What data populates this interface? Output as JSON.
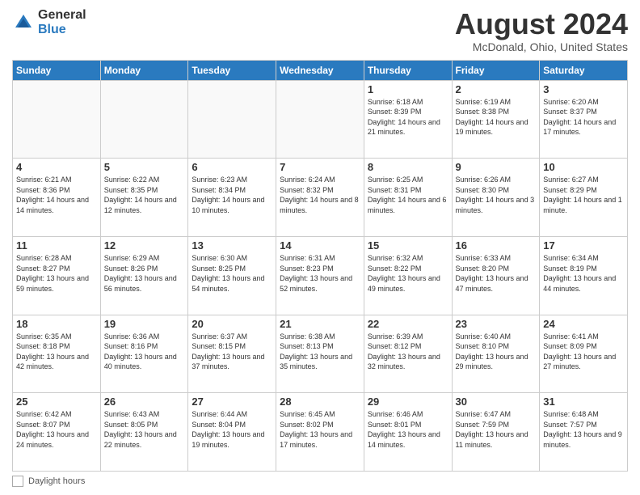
{
  "logo": {
    "general": "General",
    "blue": "Blue"
  },
  "title": "August 2024",
  "subtitle": "McDonald, Ohio, United States",
  "days_of_week": [
    "Sunday",
    "Monday",
    "Tuesday",
    "Wednesday",
    "Thursday",
    "Friday",
    "Saturday"
  ],
  "weeks": [
    [
      {
        "day": "",
        "info": ""
      },
      {
        "day": "",
        "info": ""
      },
      {
        "day": "",
        "info": ""
      },
      {
        "day": "",
        "info": ""
      },
      {
        "day": "1",
        "info": "Sunrise: 6:18 AM\nSunset: 8:39 PM\nDaylight: 14 hours and 21 minutes."
      },
      {
        "day": "2",
        "info": "Sunrise: 6:19 AM\nSunset: 8:38 PM\nDaylight: 14 hours and 19 minutes."
      },
      {
        "day": "3",
        "info": "Sunrise: 6:20 AM\nSunset: 8:37 PM\nDaylight: 14 hours and 17 minutes."
      }
    ],
    [
      {
        "day": "4",
        "info": "Sunrise: 6:21 AM\nSunset: 8:36 PM\nDaylight: 14 hours and 14 minutes."
      },
      {
        "day": "5",
        "info": "Sunrise: 6:22 AM\nSunset: 8:35 PM\nDaylight: 14 hours and 12 minutes."
      },
      {
        "day": "6",
        "info": "Sunrise: 6:23 AM\nSunset: 8:34 PM\nDaylight: 14 hours and 10 minutes."
      },
      {
        "day": "7",
        "info": "Sunrise: 6:24 AM\nSunset: 8:32 PM\nDaylight: 14 hours and 8 minutes."
      },
      {
        "day": "8",
        "info": "Sunrise: 6:25 AM\nSunset: 8:31 PM\nDaylight: 14 hours and 6 minutes."
      },
      {
        "day": "9",
        "info": "Sunrise: 6:26 AM\nSunset: 8:30 PM\nDaylight: 14 hours and 3 minutes."
      },
      {
        "day": "10",
        "info": "Sunrise: 6:27 AM\nSunset: 8:29 PM\nDaylight: 14 hours and 1 minute."
      }
    ],
    [
      {
        "day": "11",
        "info": "Sunrise: 6:28 AM\nSunset: 8:27 PM\nDaylight: 13 hours and 59 minutes."
      },
      {
        "day": "12",
        "info": "Sunrise: 6:29 AM\nSunset: 8:26 PM\nDaylight: 13 hours and 56 minutes."
      },
      {
        "day": "13",
        "info": "Sunrise: 6:30 AM\nSunset: 8:25 PM\nDaylight: 13 hours and 54 minutes."
      },
      {
        "day": "14",
        "info": "Sunrise: 6:31 AM\nSunset: 8:23 PM\nDaylight: 13 hours and 52 minutes."
      },
      {
        "day": "15",
        "info": "Sunrise: 6:32 AM\nSunset: 8:22 PM\nDaylight: 13 hours and 49 minutes."
      },
      {
        "day": "16",
        "info": "Sunrise: 6:33 AM\nSunset: 8:20 PM\nDaylight: 13 hours and 47 minutes."
      },
      {
        "day": "17",
        "info": "Sunrise: 6:34 AM\nSunset: 8:19 PM\nDaylight: 13 hours and 44 minutes."
      }
    ],
    [
      {
        "day": "18",
        "info": "Sunrise: 6:35 AM\nSunset: 8:18 PM\nDaylight: 13 hours and 42 minutes."
      },
      {
        "day": "19",
        "info": "Sunrise: 6:36 AM\nSunset: 8:16 PM\nDaylight: 13 hours and 40 minutes."
      },
      {
        "day": "20",
        "info": "Sunrise: 6:37 AM\nSunset: 8:15 PM\nDaylight: 13 hours and 37 minutes."
      },
      {
        "day": "21",
        "info": "Sunrise: 6:38 AM\nSunset: 8:13 PM\nDaylight: 13 hours and 35 minutes."
      },
      {
        "day": "22",
        "info": "Sunrise: 6:39 AM\nSunset: 8:12 PM\nDaylight: 13 hours and 32 minutes."
      },
      {
        "day": "23",
        "info": "Sunrise: 6:40 AM\nSunset: 8:10 PM\nDaylight: 13 hours and 29 minutes."
      },
      {
        "day": "24",
        "info": "Sunrise: 6:41 AM\nSunset: 8:09 PM\nDaylight: 13 hours and 27 minutes."
      }
    ],
    [
      {
        "day": "25",
        "info": "Sunrise: 6:42 AM\nSunset: 8:07 PM\nDaylight: 13 hours and 24 minutes."
      },
      {
        "day": "26",
        "info": "Sunrise: 6:43 AM\nSunset: 8:05 PM\nDaylight: 13 hours and 22 minutes."
      },
      {
        "day": "27",
        "info": "Sunrise: 6:44 AM\nSunset: 8:04 PM\nDaylight: 13 hours and 19 minutes."
      },
      {
        "day": "28",
        "info": "Sunrise: 6:45 AM\nSunset: 8:02 PM\nDaylight: 13 hours and 17 minutes."
      },
      {
        "day": "29",
        "info": "Sunrise: 6:46 AM\nSunset: 8:01 PM\nDaylight: 13 hours and 14 minutes."
      },
      {
        "day": "30",
        "info": "Sunrise: 6:47 AM\nSunset: 7:59 PM\nDaylight: 13 hours and 11 minutes."
      },
      {
        "day": "31",
        "info": "Sunrise: 6:48 AM\nSunset: 7:57 PM\nDaylight: 13 hours and 9 minutes."
      }
    ]
  ],
  "footer": {
    "label": "Daylight hours"
  },
  "colors": {
    "header_bg": "#2a7abf",
    "logo_blue": "#2a7abf"
  }
}
